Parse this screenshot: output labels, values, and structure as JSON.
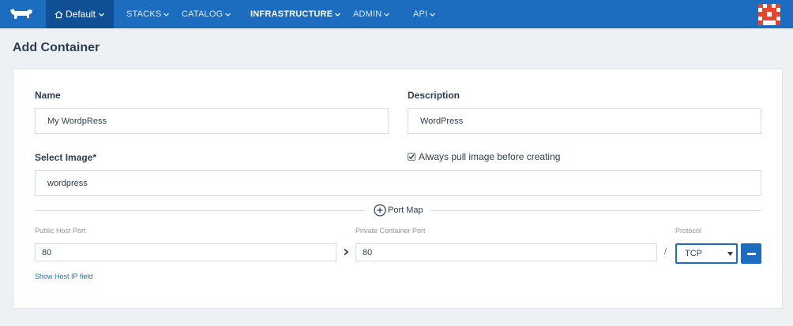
{
  "navbar": {
    "logo_icon": "rancher-cow-logo",
    "environment": {
      "icon": "home-icon",
      "label": "Default"
    },
    "items": [
      {
        "label": "STACKS",
        "active": false
      },
      {
        "label": "CATALOG",
        "active": false
      },
      {
        "label": "INFRASTRUCTURE",
        "active": true
      },
      {
        "label": "ADMIN",
        "active": false
      },
      {
        "label": "API",
        "active": false
      }
    ],
    "avatar_icon": "user-avatar-identicon"
  },
  "page": {
    "title": "Add Container"
  },
  "form": {
    "name": {
      "label": "Name",
      "value": "My WordpRess"
    },
    "description": {
      "label": "Description",
      "value": "WordPress"
    },
    "image": {
      "label": "Select Image*",
      "value": "wordpress"
    },
    "always_pull": {
      "label": "Always pull image before creating",
      "checked": true
    },
    "port_map": {
      "button_label": "Port Map",
      "public_host_port_label": "Public Host Port",
      "private_container_port_label": "Private Container Port",
      "protocol_label": "Protocol",
      "rows": [
        {
          "public_port": "80",
          "private_port": "80",
          "protocol": "TCP"
        }
      ],
      "separator": "/",
      "show_host_ip_link": "Show Host IP field"
    }
  },
  "colors": {
    "nav_bg": "#1c6cbf",
    "nav_env_bg": "#0f4f94",
    "accent": "#1c6cbf",
    "page_bg": "#eef1f4"
  }
}
